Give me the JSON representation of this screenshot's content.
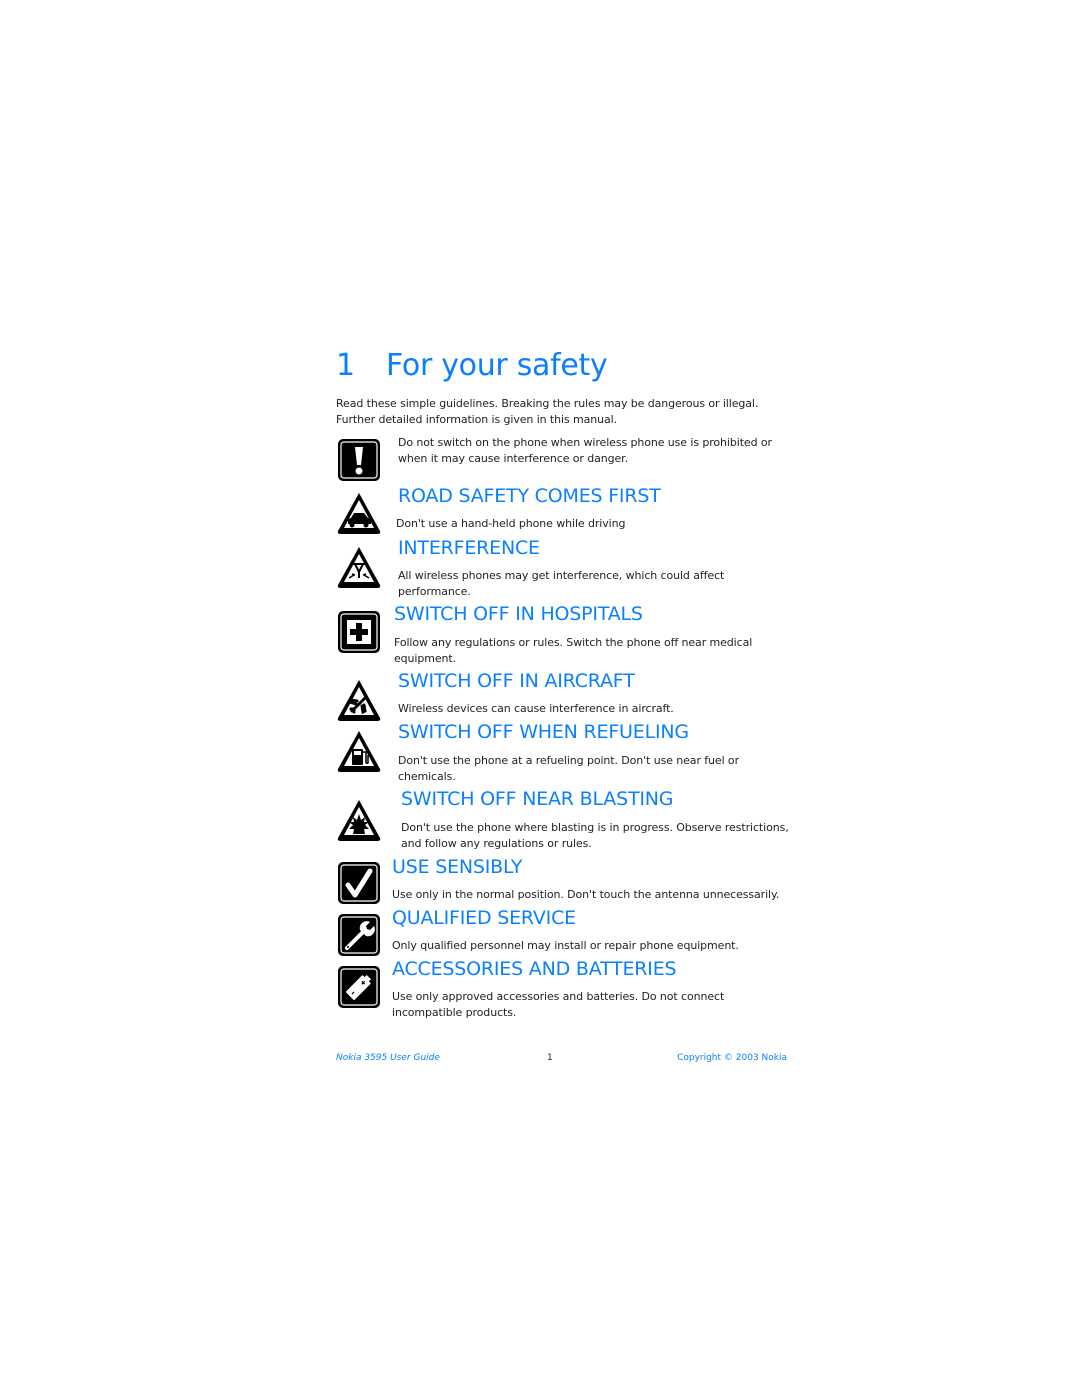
{
  "document": {
    "chapter_number": "1",
    "chapter_title": "For your safety",
    "intro_line1": "Read these simple guidelines. Breaking the rules may be dangerous or illegal.",
    "intro_line2": "Further detailed information is given in this manual.",
    "accent_color": "#0a80ff",
    "general_warning": {
      "icon": "exclamation-icon",
      "text": "Do not switch on the phone when wireless phone use is prohibited or when it may cause interference or danger."
    },
    "sections": [
      {
        "icon": "car-warning-icon",
        "heading": "ROAD SAFETY COMES FIRST",
        "text": "Don't use a hand-held phone while driving"
      },
      {
        "icon": "interference-warning-icon",
        "heading": "INTERFERENCE",
        "text": "All wireless phones may get interference, which could affect performance."
      },
      {
        "icon": "hospital-cross-icon",
        "heading": "SWITCH OFF IN HOSPITALS",
        "text": "Follow any regulations or rules. Switch the phone off near medical equipment."
      },
      {
        "icon": "aircraft-warning-icon",
        "heading": "SWITCH OFF IN AIRCRAFT",
        "text": "Wireless devices can cause interference in aircraft."
      },
      {
        "icon": "fuel-pump-warning-icon",
        "heading": "SWITCH OFF WHEN REFUELING",
        "text": "Don't use the phone at a refueling point. Don't use near fuel or chemicals."
      },
      {
        "icon": "blasting-warning-icon",
        "heading": "SWITCH OFF NEAR BLASTING",
        "text": "Don't use the phone where blasting is in progress. Observe restrictions, and follow any regulations or rules."
      },
      {
        "icon": "checkmark-icon",
        "heading": "USE SENSIBLY",
        "text": "Use only in the normal position. Don't touch the antenna unnecessarily."
      },
      {
        "icon": "wrench-icon",
        "heading": "QUALIFIED SERVICE",
        "text": "Only qualified personnel may install or repair phone equipment."
      },
      {
        "icon": "battery-icon",
        "heading": "ACCESSORIES AND BATTERIES",
        "text": "Use only approved accessories and batteries. Do not connect incompatible products."
      }
    ],
    "footer": {
      "title": "Nokia 3595 User Guide",
      "page_number": "1",
      "copyright": "Copyright © 2003 Nokia"
    }
  }
}
